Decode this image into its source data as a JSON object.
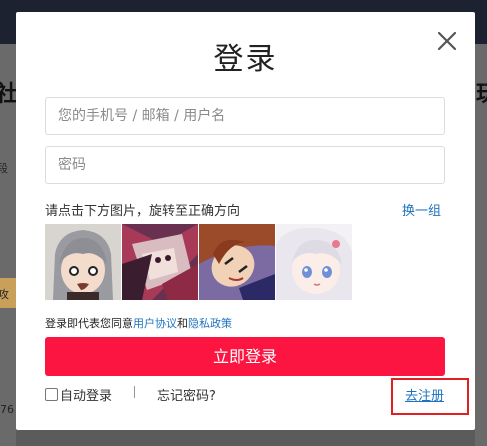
{
  "modal": {
    "title": "登录",
    "phone_placeholder": "您的手机号 / 邮箱 / 用户名",
    "password_placeholder": "密码",
    "captcha_hint": "请点击下方图片，旋转至正确方向",
    "switch_label": "换一组",
    "agreement_prefix": "登录即代表您同意",
    "user_agreement": "用户协议",
    "agreement_and": "和",
    "privacy_policy": "隐私政策",
    "login_button": "立即登录",
    "auto_login": "自动登录",
    "forgot_password": "忘记密码?",
    "register": "去注册"
  },
  "background": {
    "fragments": [
      "社",
      "玩",
      "段",
      "攻",
      "76"
    ]
  },
  "colors": {
    "accent": "#fb1540",
    "link": "#1e73be",
    "highlight": "#e02020"
  },
  "icons": [
    "close-icon",
    "checkbox-icon"
  ]
}
